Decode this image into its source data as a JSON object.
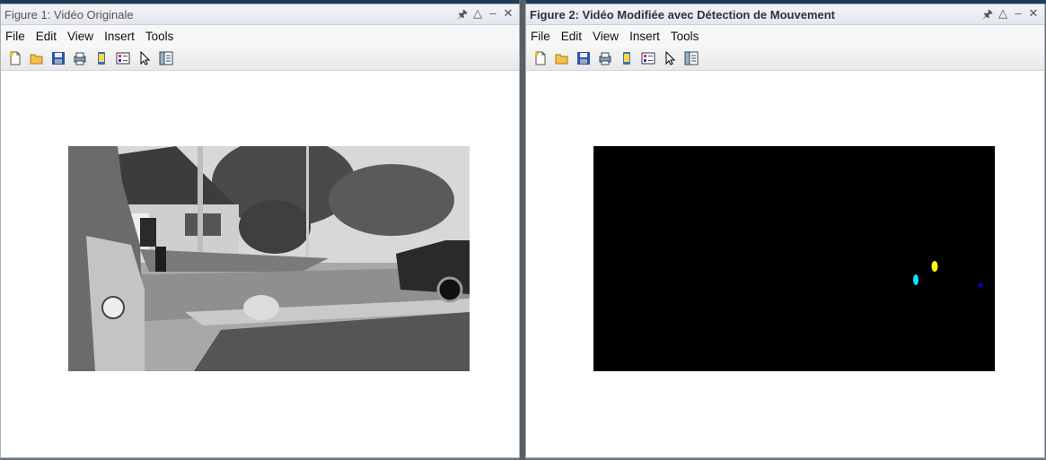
{
  "windows": [
    {
      "title": "Figure 1: Vidéo Originale",
      "menu": [
        "File",
        "Edit",
        "View",
        "Insert",
        "Tools"
      ],
      "toolbar_icons": [
        "new-file-icon",
        "open-folder-icon",
        "save-icon",
        "print-icon",
        "phone-icon",
        "color-palette-icon",
        "pointer-icon",
        "property-panel-icon"
      ]
    },
    {
      "title": "Figure 2: Vidéo Modifiée avec Détection de Mouvement",
      "menu": [
        "File",
        "Edit",
        "View",
        "Insert",
        "Tools"
      ],
      "toolbar_icons": [
        "new-file-icon",
        "open-folder-icon",
        "save-icon",
        "print-icon",
        "phone-icon",
        "color-palette-icon",
        "pointer-icon",
        "property-panel-icon"
      ]
    }
  ],
  "window_controls": [
    "pin-icon",
    "restore-icon",
    "minimize-icon",
    "close-icon"
  ],
  "detection_blob_colors": [
    "#ffff00",
    "#00e5ff",
    "#0000cc"
  ]
}
